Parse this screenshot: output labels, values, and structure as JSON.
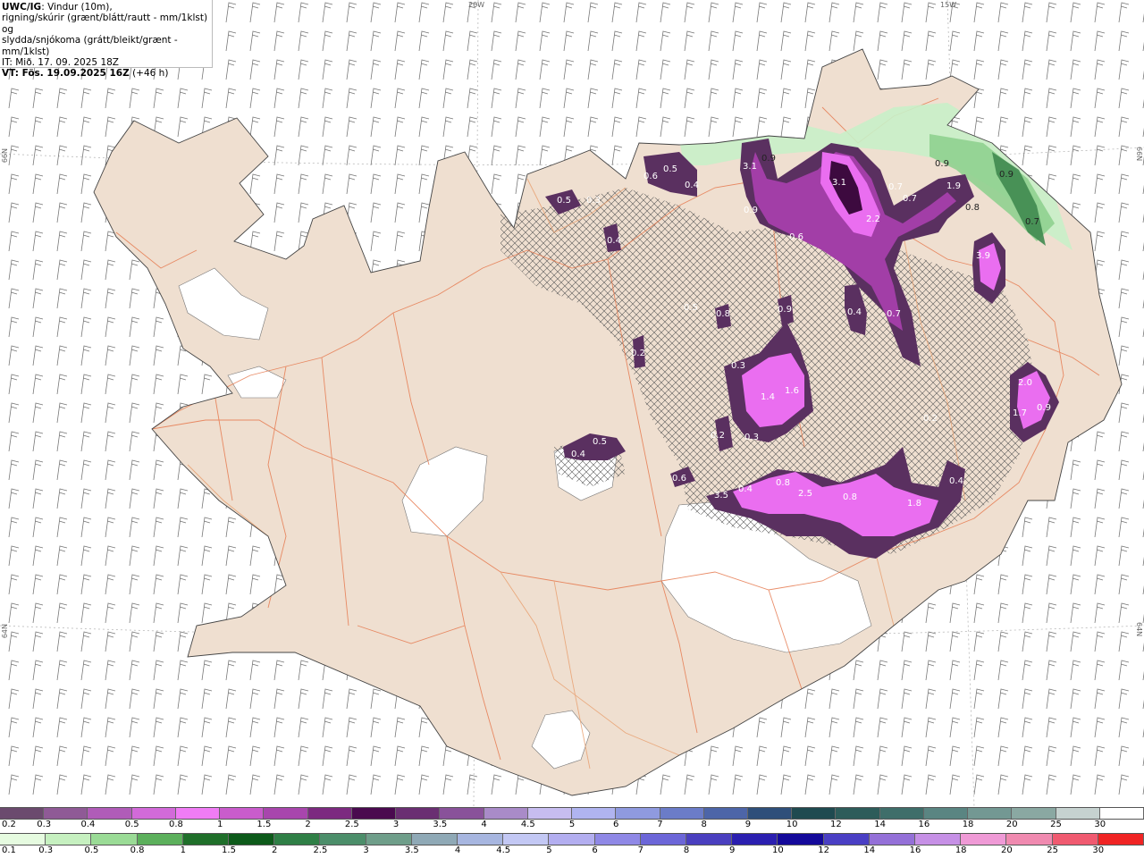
{
  "header": {
    "model": "UWC/IG",
    "line1": ": Vindur (10m),",
    "line2": "rigning/skúrir (grænt/blátt/rautt - mm/1klst) og",
    "line3": "slydda/snjókoma (grátt/bleikt/grænt - mm/1klst)",
    "line4": "IT: Mið. 17. 09. 2025 18Z",
    "line5_bold": "VT: Fös. 19.09.2025 16Z",
    "line5_rest": " (+46 h)"
  },
  "graticule": {
    "lon_top": [
      "20W",
      "15W"
    ],
    "lat_left": [
      "66N",
      "64N"
    ],
    "lat_right": [
      "66N",
      "64N"
    ]
  },
  "map_colors": {
    "sea": "#ffffff",
    "land": "#efdfd0",
    "glacier": "#ffffff",
    "roads": "#e67a4f",
    "rivers": "#e8a070",
    "snow_light": "#5a3060",
    "snow_mid": "#a23ea7",
    "snow_heavy": "#ea6ef0",
    "snow_core": "#3d0a3f",
    "rain_light": "#c8f0c8",
    "rain_mid": "#8fd08f",
    "rain_heavy": "#3f8a4f"
  },
  "precip_labels": [
    {
      "text": "3.1"
    },
    {
      "text": "3.1"
    },
    {
      "text": "2.2"
    },
    {
      "text": "0.7"
    },
    {
      "text": "0.7"
    },
    {
      "text": "1.9"
    },
    {
      "text": "0.9"
    },
    {
      "text": "0.9"
    },
    {
      "text": "0.7"
    },
    {
      "text": "0.8"
    },
    {
      "text": "3.9"
    },
    {
      "text": "0.9"
    },
    {
      "text": "0.6"
    },
    {
      "text": "0.5"
    },
    {
      "text": "0.3"
    },
    {
      "text": "0.4"
    },
    {
      "text": "0.5"
    },
    {
      "text": "0.6"
    },
    {
      "text": "0.4"
    },
    {
      "text": "0.9"
    },
    {
      "text": "0.4"
    },
    {
      "text": "0.7"
    },
    {
      "text": "0.8"
    },
    {
      "text": "0.5"
    },
    {
      "text": "0.3"
    },
    {
      "text": "0.2"
    },
    {
      "text": "1.4"
    },
    {
      "text": "1.6"
    },
    {
      "text": "0.3"
    },
    {
      "text": "0.2"
    },
    {
      "text": "0.2"
    },
    {
      "text": "2.0"
    },
    {
      "text": "1.7"
    },
    {
      "text": "0.9"
    },
    {
      "text": "0.5"
    },
    {
      "text": "0.4"
    },
    {
      "text": "0.4"
    },
    {
      "text": "0.8"
    },
    {
      "text": "2.5"
    },
    {
      "text": "0.8"
    },
    {
      "text": "1.8"
    },
    {
      "text": "0.4"
    },
    {
      "text": "3.5"
    },
    {
      "text": "0.6"
    },
    {
      "text": "0.9"
    }
  ],
  "legend_snow": {
    "labels": [
      "0.2",
      "0.3",
      "0.4",
      "0.5",
      "0.8",
      "1",
      "1.5",
      "2",
      "2.5",
      "3",
      "3.5",
      "4",
      "4.5",
      "5",
      "6",
      "7",
      "8",
      "9",
      "10",
      "12",
      "14",
      "16",
      "18",
      "20",
      "25",
      "30"
    ],
    "colors": [
      "#6b4a6e",
      "#8f5a96",
      "#b05cb8",
      "#d26ad9",
      "#f07cf5",
      "#c95ccc",
      "#a846ad",
      "#7c2a80",
      "#4a0a4f",
      "#6a2f72",
      "#89529a",
      "#a98bc8",
      "#c7bdf0",
      "#b0b4f0",
      "#8f9adf",
      "#6b7cc8",
      "#4d65a8",
      "#2f4f7a",
      "#1f4a50",
      "#2d5c5a",
      "#3f6e6a",
      "#5a8582",
      "#739893",
      "#8aa8a2",
      "#c6d2d0",
      "#ffffff"
    ]
  },
  "legend_rain": {
    "labels": [
      "0.1",
      "0.3",
      "0.5",
      "0.8",
      "1",
      "1.5",
      "2",
      "2.5",
      "3",
      "3.5",
      "4",
      "4.5",
      "5",
      "6",
      "7",
      "8",
      "9",
      "10",
      "12",
      "14",
      "16",
      "18",
      "20",
      "25",
      "30"
    ],
    "colors": [
      "#e6fbe0",
      "#c6f0c0",
      "#9adb96",
      "#5cb05c",
      "#1f6f2a",
      "#0d5a1a",
      "#2f7f46",
      "#4c8e6a",
      "#6f9e8a",
      "#8fa9b6",
      "#a7b6e0",
      "#c3c8f4",
      "#b3aef0",
      "#8f88e6",
      "#6c66d8",
      "#4a3fbf",
      "#2b1fb0",
      "#14099a",
      "#4a3fc4",
      "#9470d8",
      "#c690e6",
      "#ef9ad6",
      "#f08ab0",
      "#f05a70",
      "#f02424"
    ]
  }
}
